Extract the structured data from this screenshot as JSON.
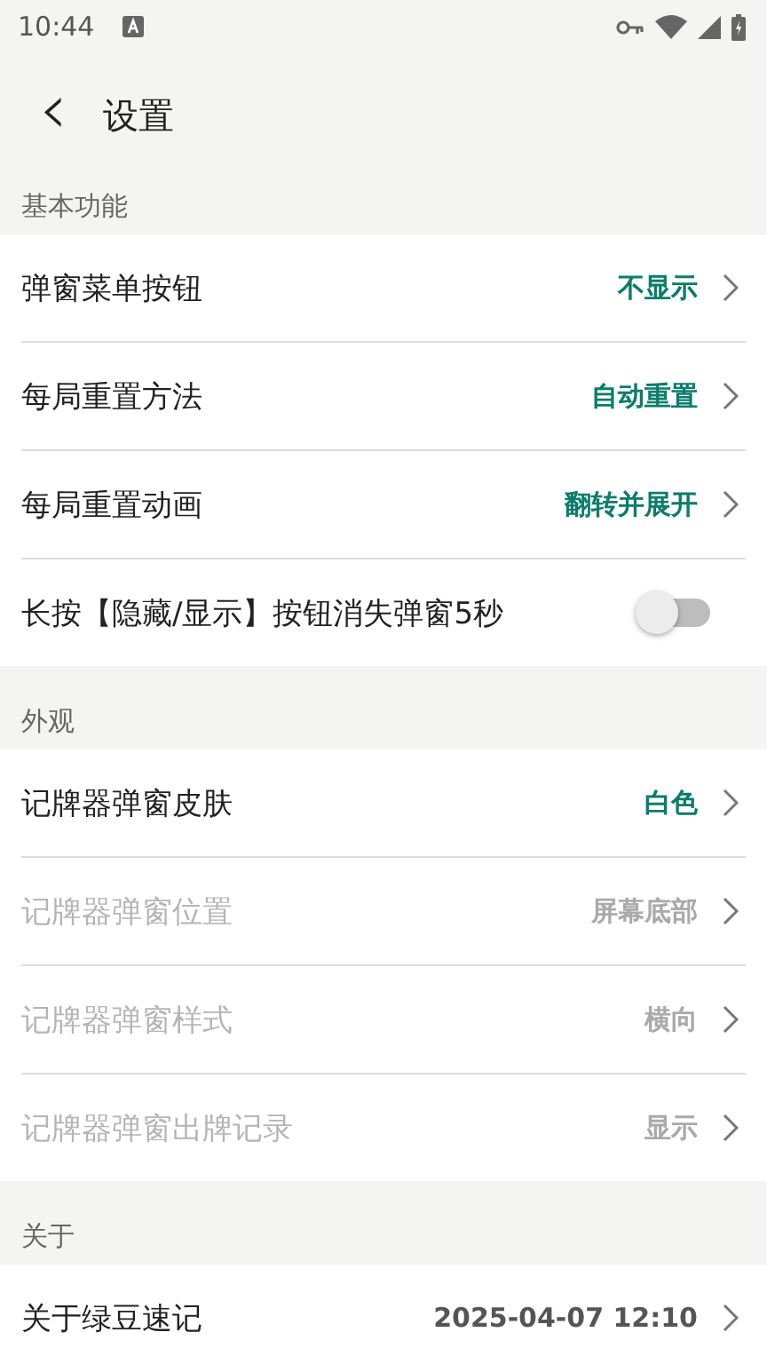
{
  "status_bar": {
    "time": "10:44"
  },
  "header": {
    "back": "‹",
    "title": "设置"
  },
  "sections": [
    {
      "title": "基本功能",
      "items": [
        {
          "kind": "link",
          "label": "弹窗菜单按钮",
          "value": "不显示",
          "disabled": false
        },
        {
          "kind": "link",
          "label": "每局重置方法",
          "value": "自动重置",
          "disabled": false
        },
        {
          "kind": "link",
          "label": "每局重置动画",
          "value": "翻转并展开",
          "disabled": false
        },
        {
          "kind": "toggle",
          "label": "长按【隐藏/显示】按钮消失弹窗5秒",
          "on": false,
          "disabled": false
        }
      ]
    },
    {
      "title": "外观",
      "items": [
        {
          "kind": "link",
          "label": "记牌器弹窗皮肤",
          "value": "白色",
          "disabled": false
        },
        {
          "kind": "link",
          "label": "记牌器弹窗位置",
          "value": "屏幕底部",
          "disabled": true
        },
        {
          "kind": "link",
          "label": "记牌器弹窗样式",
          "value": "横向",
          "disabled": true
        },
        {
          "kind": "link",
          "label": "记牌器弹窗出牌记录",
          "value": "显示",
          "disabled": true
        }
      ]
    },
    {
      "title": "关于",
      "items": [
        {
          "kind": "info",
          "label": "关于绿豆速记",
          "value": "2025-04-07 12:10",
          "disabled": false
        }
      ]
    }
  ]
}
